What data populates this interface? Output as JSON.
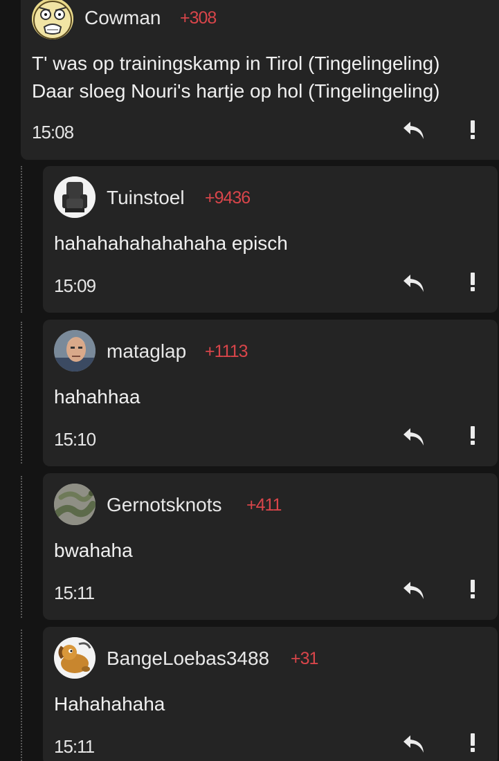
{
  "comments": [
    {
      "username": "Cowman",
      "score": "+308",
      "lines": [
        "T' was op trainingskamp in Tirol (Tingelingeling)",
        "Daar sloeg Nouri's hartje op hol (Tingelingeling)"
      ],
      "time": "15:08",
      "avatar_icon": "shocked-face-icon"
    },
    {
      "username": "Tuinstoel",
      "score": "+9436",
      "lines": [
        "hahahahahahahaha episch"
      ],
      "time": "15:09",
      "avatar_icon": "armchair-icon"
    },
    {
      "username": "mataglap",
      "score": "+1113",
      "lines": [
        "hahahhaa"
      ],
      "time": "15:10",
      "avatar_icon": "man-portrait-icon"
    },
    {
      "username": "Gernotsknots",
      "score": "+411",
      "lines": [
        "bwahaha"
      ],
      "time": "15:11",
      "avatar_icon": "snake-icon"
    },
    {
      "username": "BangeLoebas3488",
      "score": "+31",
      "lines": [
        "Hahahahaha"
      ],
      "time": "15:11",
      "avatar_icon": "cartoon-dog-icon"
    }
  ],
  "colors": {
    "page_background": "#141414",
    "card_background": "#242424",
    "score": "#d8454a",
    "text": "#f0f0f0"
  }
}
